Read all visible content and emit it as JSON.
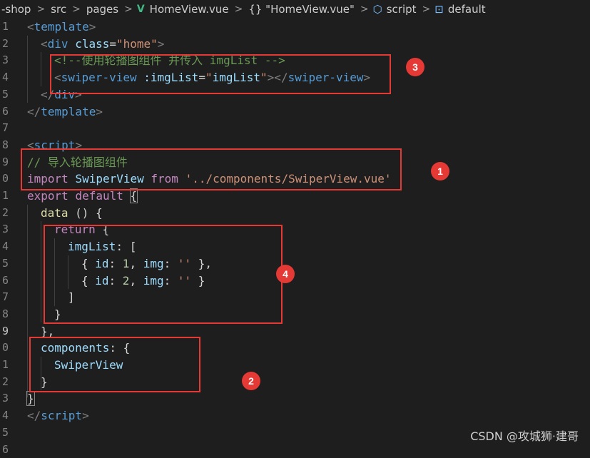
{
  "breadcrumb": {
    "items": [
      "-shop",
      "src",
      "pages",
      "HomeView.vue",
      "{} \"HomeView.vue\"",
      "script",
      "default"
    ],
    "separator": ">"
  },
  "gutter": {
    "numbers": [
      "1",
      "2",
      "3",
      "4",
      "5",
      "6",
      "7",
      "8",
      "9",
      "0",
      "1",
      "2",
      "3",
      "4",
      "5",
      "6",
      "7",
      "8",
      "9",
      "0",
      "1",
      "2",
      "3",
      "4",
      "5",
      "6"
    ],
    "active_index": 18
  },
  "code": {
    "l1": [
      "<",
      "template",
      ">"
    ],
    "l2": [
      "<",
      "div",
      "class",
      "=",
      "\"home\"",
      ">"
    ],
    "l3": "<!--使用轮播图组件 并传入 imgList -->",
    "l4": [
      "<",
      "swiper-view",
      ":imgList",
      "=",
      "\"",
      "imgList",
      "\"",
      "></",
      "swiper-view",
      ">"
    ],
    "l5": [
      "</",
      "div",
      ">"
    ],
    "l6": [
      "</",
      "template",
      ">"
    ],
    "l8": [
      "<",
      "script",
      ">"
    ],
    "l9": "// 导入轮播图组件",
    "l10": [
      "import",
      "SwiperView",
      "from",
      "'../components/SwiperView.vue'"
    ],
    "l11": [
      "export",
      "default",
      "{"
    ],
    "l12": [
      "data",
      "()",
      "{"
    ],
    "l13": [
      "return",
      "{"
    ],
    "l14": [
      "imgList",
      ": ["
    ],
    "l15": [
      "{ ",
      "id",
      ": ",
      "1",
      ", ",
      "img",
      ": ",
      "''",
      " },"
    ],
    "l16": [
      "{ ",
      "id",
      ": ",
      "2",
      ", ",
      "img",
      ": ",
      "''",
      " }"
    ],
    "l17": "]",
    "l18": "}",
    "l19": "},",
    "l20": [
      "components",
      ": {"
    ],
    "l21": "SwiperView",
    "l22": "}",
    "l23": "}",
    "l24": [
      "</",
      "script",
      ">"
    ]
  },
  "annotations": [
    "1",
    "2",
    "3",
    "4"
  ],
  "watermark": "CSDN @攻城狮·建哥",
  "colors": {
    "background": "#1e1e1e",
    "annotation": "#e53935",
    "tag": "#569cd6",
    "string": "#ce9178",
    "comment": "#6a9955",
    "keyword": "#c586c0"
  }
}
